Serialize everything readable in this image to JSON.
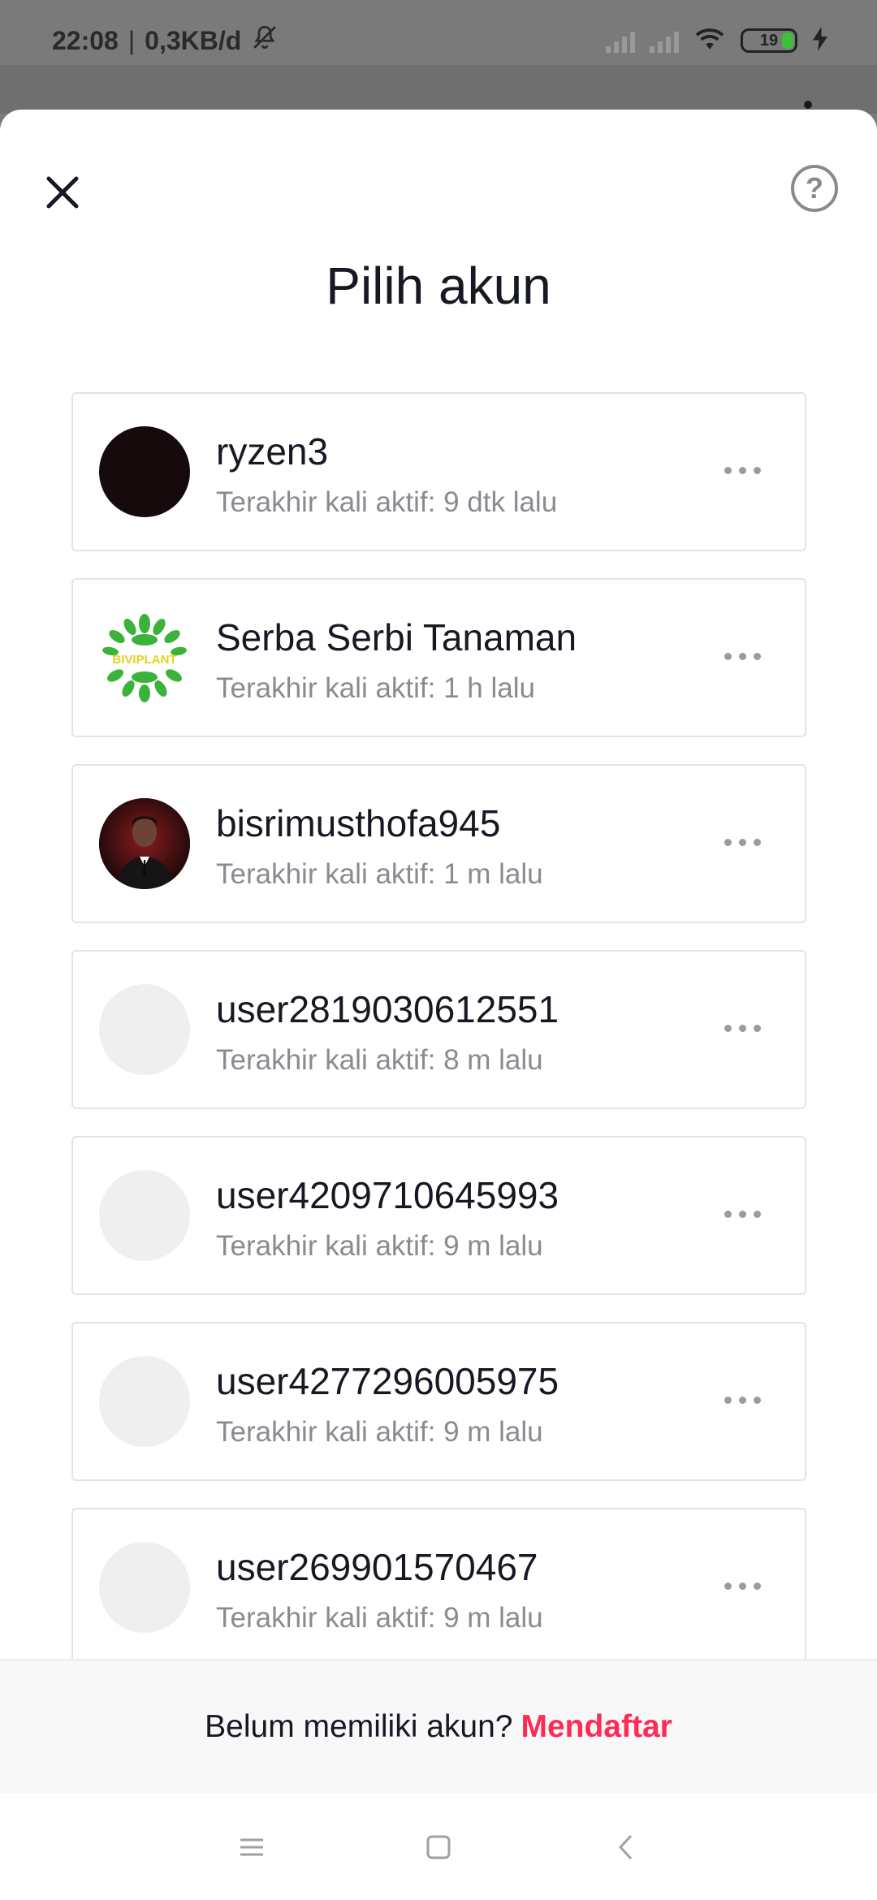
{
  "status_bar": {
    "time": "22:08",
    "separator": "|",
    "network_speed": "0,3KB/d",
    "battery_level": "19",
    "icons": [
      "mute-icon",
      "signal-icon",
      "signal-icon",
      "wifi-icon",
      "battery-icon",
      "charging-icon"
    ]
  },
  "header": {
    "title": "Pilih akun",
    "close_icon": "close-icon",
    "help_icon": "help-icon",
    "help_glyph": "?"
  },
  "accounts": [
    {
      "name": "ryzen3",
      "last_active": "Terakhir kali aktif: 9 dtk lalu",
      "avatar": "dark"
    },
    {
      "name": "Serba Serbi Tanaman",
      "last_active": "Terakhir kali aktif: 1 h lalu",
      "avatar": "plant",
      "avatar_text": "BIVIPLANT"
    },
    {
      "name": "bisrimusthofa945",
      "last_active": "Terakhir kali aktif: 1 m lalu",
      "avatar": "photo"
    },
    {
      "name": "user2819030612551",
      "last_active": "Terakhir kali aktif: 8 m lalu",
      "avatar": "default"
    },
    {
      "name": "user4209710645993",
      "last_active": "Terakhir kali aktif: 9 m lalu",
      "avatar": "default"
    },
    {
      "name": "user4277296005975",
      "last_active": "Terakhir kali aktif: 9 m lalu",
      "avatar": "default"
    },
    {
      "name": "user269901570467",
      "last_active": "Terakhir kali aktif: 9 m lalu",
      "avatar": "default"
    }
  ],
  "footer": {
    "prompt": "Belum memiliki akun?",
    "signup_label": "Mendaftar"
  },
  "colors": {
    "accent": "#fe2c55",
    "text": "#161823",
    "muted": "#8a8b91"
  },
  "nav": {
    "icons": [
      "menu-icon",
      "home-icon",
      "back-icon"
    ]
  }
}
